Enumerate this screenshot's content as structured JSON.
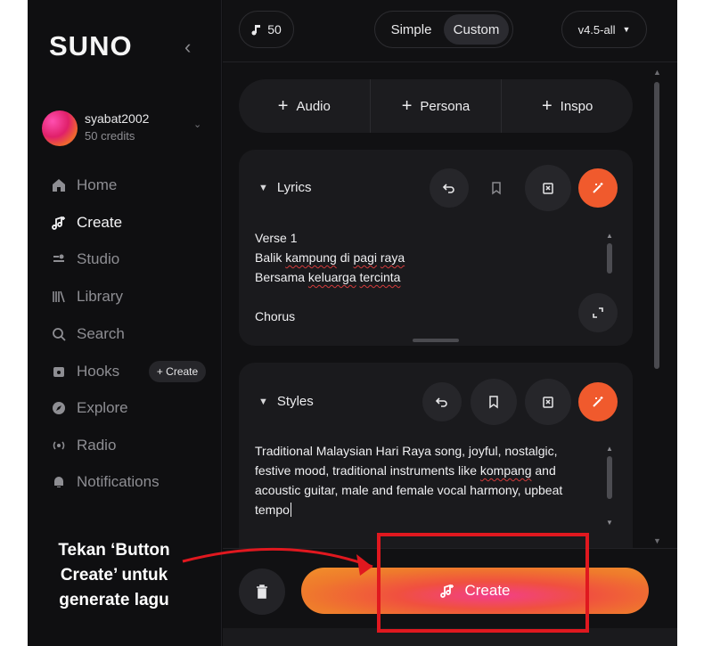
{
  "sidebar": {
    "logo": "SUNO",
    "user": {
      "name": "syabat2002",
      "credits": "50 credits"
    },
    "nav": [
      {
        "label": "Home",
        "icon": "home-icon"
      },
      {
        "label": "Create",
        "icon": "create-music-icon"
      },
      {
        "label": "Studio",
        "icon": "studio-icon"
      },
      {
        "label": "Library",
        "icon": "library-icon"
      },
      {
        "label": "Search",
        "icon": "search-icon"
      },
      {
        "label": "Hooks",
        "icon": "hooks-icon"
      },
      {
        "label": "Explore",
        "icon": "explore-icon"
      },
      {
        "label": "Radio",
        "icon": "radio-icon"
      },
      {
        "label": "Notifications",
        "icon": "bell-icon"
      }
    ],
    "hooks_create": "+ Create"
  },
  "topbar": {
    "credits": "50",
    "mode_simple": "Simple",
    "mode_custom": "Custom",
    "version": "v4.5-all"
  },
  "add": {
    "audio": "Audio",
    "persona": "Persona",
    "inspo": "Inspo"
  },
  "lyrics": {
    "title": "Lyrics",
    "line1": "Verse 1",
    "line2_a": "Balik ",
    "line2_b": "kampung",
    "line2_c": " di ",
    "line2_d": "pagi",
    "line2_e": " ",
    "line2_f": "raya",
    "line3_a": "Bersama ",
    "line3_b": "keluarga",
    "line3_c": " ",
    "line3_d": "tercinta",
    "line4": "Chorus"
  },
  "styles": {
    "title": "Styles",
    "l1": "Traditional Malaysian Hari Raya song, joyful, nostalgic,",
    "l2a": "festive mood, traditional instruments like ",
    "l2b": "kompang",
    "l2c": " and",
    "l3": "acoustic guitar, male and female vocal harmony, upbeat",
    "l4": "tempo"
  },
  "create_label": "Create",
  "annotation": {
    "line1": "Tekan ‘Button",
    "line2": "Create’ untuk",
    "line3": "generate lagu"
  },
  "colors": {
    "accent": "#f05a2d",
    "highlight": "#e0181f"
  }
}
